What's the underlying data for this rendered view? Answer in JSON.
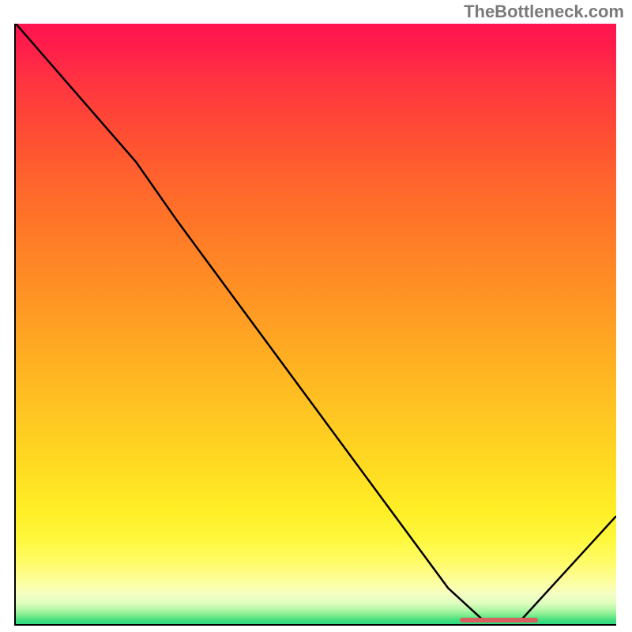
{
  "watermark": "TheBottleneck.com",
  "chart_data": {
    "type": "line",
    "title": "",
    "xlabel": "",
    "ylabel": "",
    "xlim": [
      0,
      100
    ],
    "ylim": [
      0,
      100
    ],
    "curve_points": [
      {
        "x": 0,
        "y": 100
      },
      {
        "x": 20,
        "y": 77
      },
      {
        "x": 27,
        "y": 67
      },
      {
        "x": 72,
        "y": 6
      },
      {
        "x": 78,
        "y": 0.5
      },
      {
        "x": 84,
        "y": 0.5
      },
      {
        "x": 100,
        "y": 18
      }
    ],
    "marker": {
      "x_start": 74,
      "x_end": 87,
      "y": 0.7,
      "color": "#d86060"
    },
    "gradient_stops": [
      {
        "pos": 0,
        "color": "#ff1450"
      },
      {
        "pos": 50,
        "color": "#ffa823"
      },
      {
        "pos": 85,
        "color": "#fff640"
      },
      {
        "pos": 100,
        "color": "#2cd880"
      }
    ]
  }
}
